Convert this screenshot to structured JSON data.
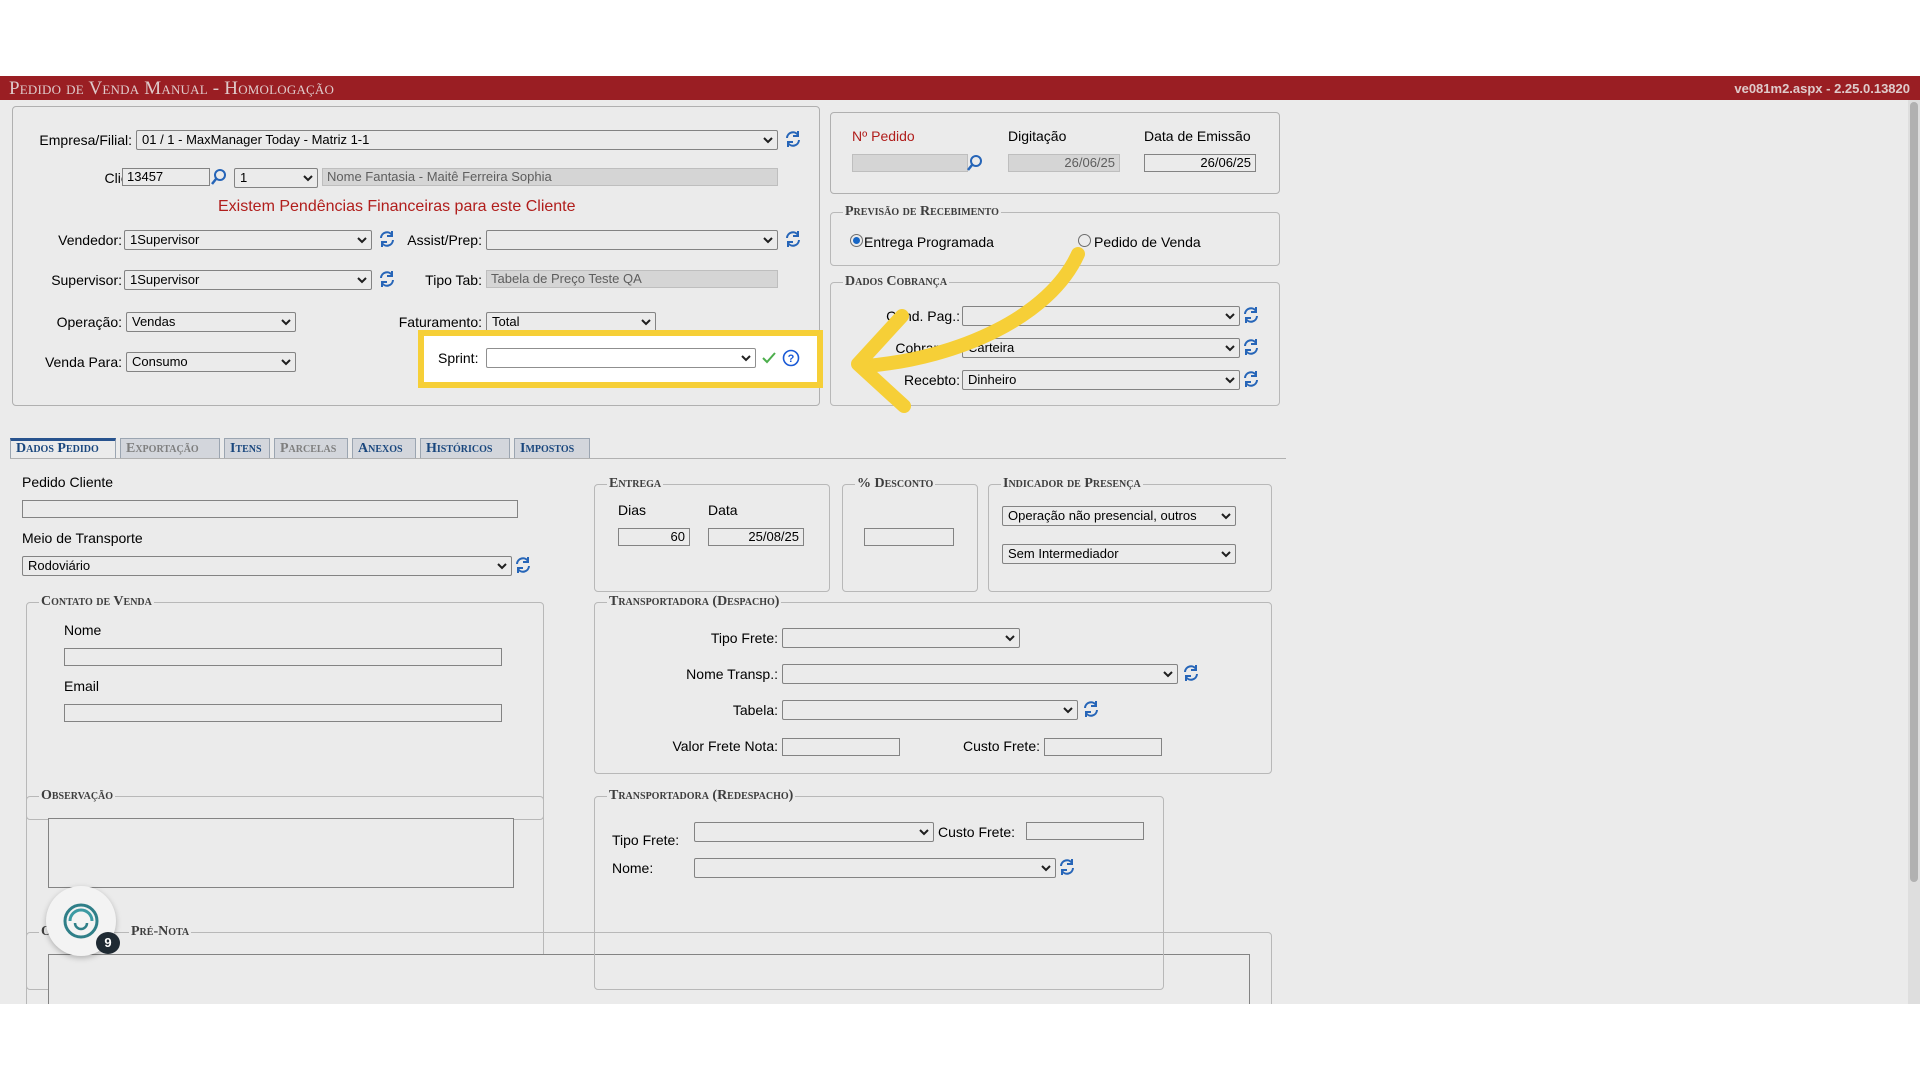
{
  "app": {
    "title": "Pedido de Venda Manual   - Homologação",
    "version": "ve081m2.aspx - 2.25.0.13820"
  },
  "header": {
    "empresa_label": "Empresa/Filial:",
    "empresa_value": "01 / 1 - MaxManager Today - Matriz 1-1",
    "cliente_label": "Cliente:",
    "cliente_code": "13457",
    "cliente_seq": "1",
    "cliente_nome": "Nome Fantasia - Maitê Ferreira Sophia",
    "pendencias": "Existem Pendências Financeiras para este Cliente",
    "vendedor_label": "Vendedor:",
    "vendedor_value": "1Supervisor",
    "assist_label": "Assist/Prep:",
    "assist_value": "",
    "supervisor_label": "Supervisor:",
    "supervisor_value": "1Supervisor",
    "tipotab_label": "Tipo Tab:",
    "tipotab_value": "Tabela de Preço Teste QA",
    "operacao_label": "Operação:",
    "operacao_value": "Vendas",
    "faturamento_label": "Faturamento:",
    "faturamento_value": "Total",
    "vendapara_label": "Venda Para:",
    "vendapara_value": "Consumo",
    "sprint_label": "Sprint:",
    "sprint_value": ""
  },
  "pedido_info": {
    "numero_label": "Nº Pedido",
    "numero_value": "",
    "digitacao_label": "Digitação",
    "digitacao_value": "26/06/25",
    "emissao_label": "Data de Emissão",
    "emissao_value": "26/06/25"
  },
  "previsao": {
    "legend": "Previsão de Recebimento",
    "option1": "Entrega Programada",
    "option2": "Pedido de Venda",
    "selected": "Entrega Programada"
  },
  "cobranca": {
    "legend": "Dados Cobrança",
    "cond_label": "Cond. Pag.:",
    "cond_value": "",
    "cobranca_label": "Cobrança:",
    "cobranca_value": "Carteira",
    "forma_label": "Recebto:",
    "forma_value": "Dinheiro"
  },
  "tabs": [
    {
      "label": "Dados Pedido"
    },
    {
      "label": "Exportação"
    },
    {
      "label": "Itens"
    },
    {
      "label": "Parcelas"
    },
    {
      "label": "Anexos"
    },
    {
      "label": "Históricos"
    },
    {
      "label": "Impostos"
    }
  ],
  "dados": {
    "pedido_cliente_label": "Pedido Cliente",
    "pedido_cliente_value": "",
    "meio_label": "Meio de Transporte",
    "meio_value": "Rodoviário",
    "contato_legend": "Contato de Venda",
    "nome_label": "Nome",
    "nome_value": "",
    "email_label": "Email",
    "email_value": "",
    "obs_legend": "Observação",
    "prenota_legend": "Pré-Nota",
    "prenota_prefix": "O"
  },
  "entrega": {
    "legend": "Entrega",
    "dias_label": "Dias",
    "dias_value": "60",
    "data_label": "Data",
    "data_value": "25/08/25"
  },
  "desconto": {
    "legend": "% Desconto",
    "value": ""
  },
  "presenca": {
    "legend": "Indicador de Presença",
    "value1": "Operação não presencial, outros",
    "value2": "Sem Intermediador"
  },
  "despacho": {
    "legend": "Transportadora (Despacho)",
    "tipo_frete_label": "Tipo Frete:",
    "tipo_frete_value": "",
    "nome_transp_label": "Nome Transp.:",
    "nome_transp_value": "",
    "tabela_label": "Tabela:",
    "tabela_value": "",
    "valor_frete_label": "Valor Frete Nota:",
    "valor_frete_value": "",
    "custo_frete_label": "Custo Frete:",
    "custo_frete_value": ""
  },
  "redespacho": {
    "legend": "Transportadora (Redespacho)",
    "tipo_frete_label": "Tipo Frete:",
    "tipo_frete_value": "",
    "custo_frete_label": "Custo Frete:",
    "custo_frete_value": "",
    "nome_label": "Nome:",
    "nome_value": ""
  },
  "widget": {
    "badge_count": "9"
  },
  "colors": {
    "titlebar": "#a82127",
    "highlight": "#f6cf37",
    "tab_text": "#1d4e89",
    "alert_text": "#c0211f"
  }
}
